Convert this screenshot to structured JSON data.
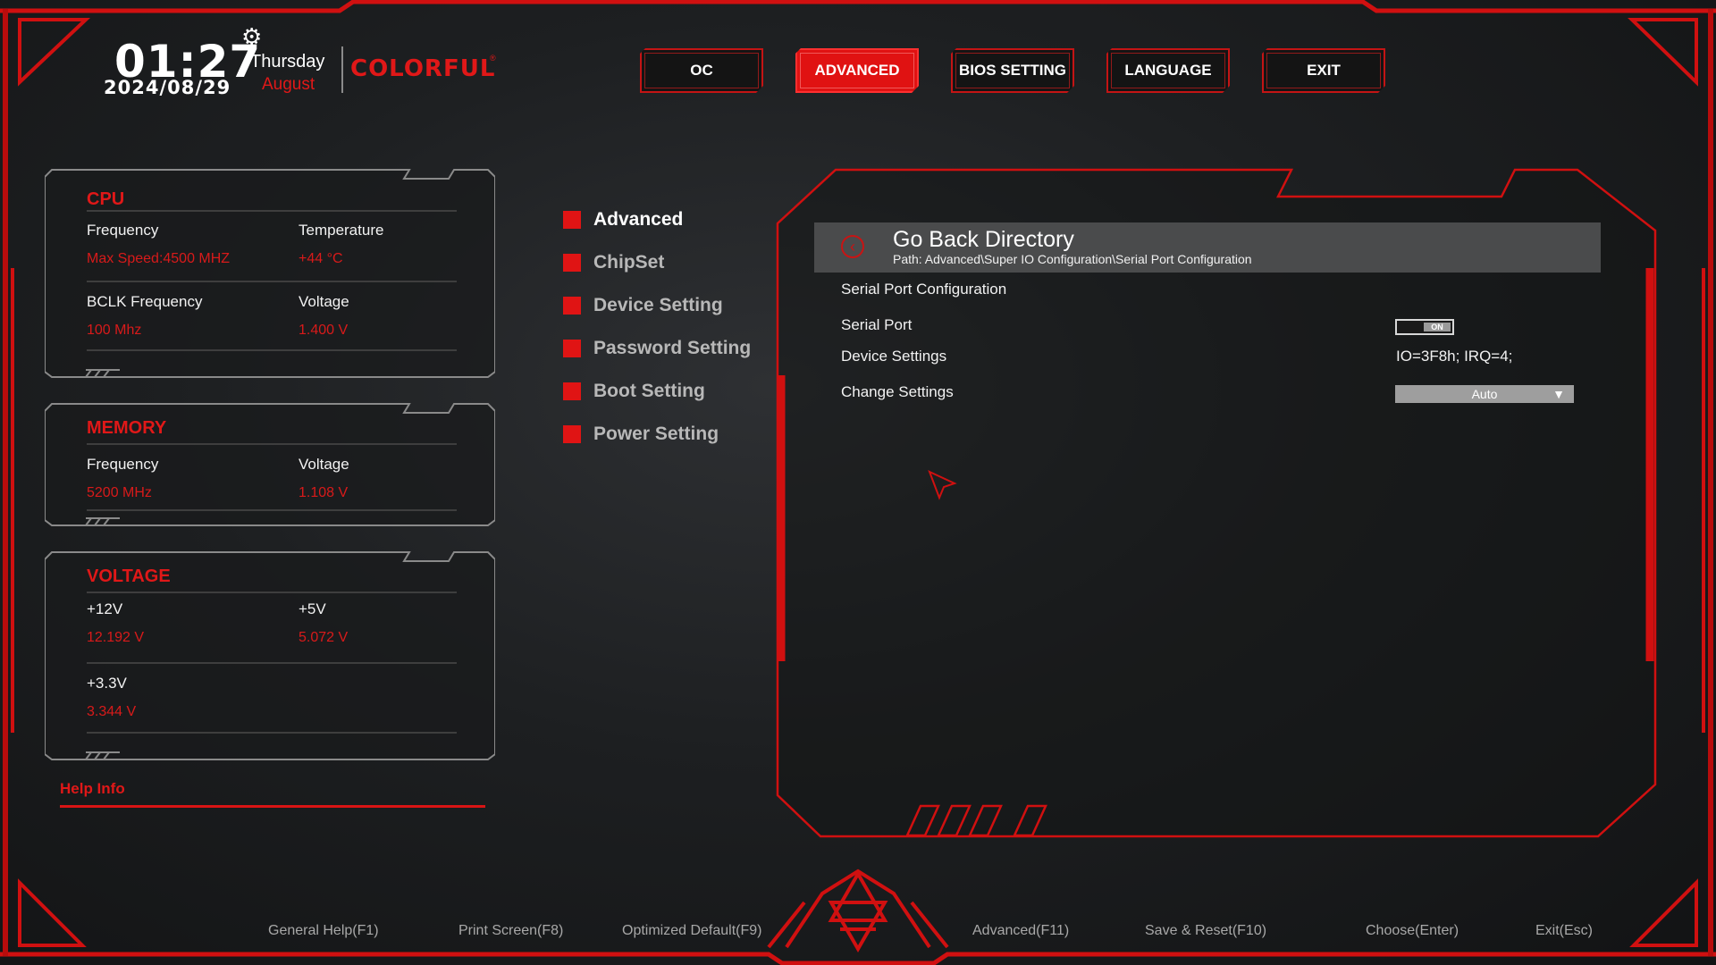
{
  "header": {
    "time": "01:27",
    "date": "2024/08/29",
    "weekday": "Thursday",
    "month": "August",
    "brand": "COLORFUL",
    "brand_mark": "®"
  },
  "nav": [
    "OC",
    "ADVANCED",
    "BIOS SETTING",
    "LANGUAGE",
    "EXIT"
  ],
  "nav_active": "ADVANCED",
  "cpu": {
    "title": "CPU",
    "frequency_label": "Frequency",
    "frequency_value": "Max Speed:4500 MHZ",
    "temperature_label": "Temperature",
    "temperature_value": "+44 °C",
    "bclk_label": "BCLK Frequency",
    "bclk_value": "100 Mhz",
    "voltage_label": "Voltage",
    "voltage_value": "1.400 V"
  },
  "memory": {
    "title": "MEMORY",
    "frequency_label": "Frequency",
    "frequency_value": "5200 MHz",
    "voltage_label": "Voltage",
    "voltage_value": "1.108 V"
  },
  "voltage": {
    "title": "VOLTAGE",
    "v12_label": "+12V",
    "v12_value": "12.192 V",
    "v5_label": "+5V",
    "v5_value": "5.072 V",
    "v33_label": "+3.3V",
    "v33_value": "3.344 V"
  },
  "help_info": "Help Info",
  "submenu": [
    "Advanced",
    "ChipSet",
    "Device Setting",
    "Password Setting",
    "Boot Setting",
    "Power Setting"
  ],
  "content": {
    "go_back_title": "Go Back Directory",
    "path": "Path: Advanced\\Super IO Configuration\\Serial Port Configuration",
    "section_title": "Serial Port Configuration",
    "serial_port_label": "Serial Port",
    "serial_port_toggle": "ON",
    "device_settings_label": "Device Settings",
    "device_settings_value": "IO=3F8h; IRQ=4;",
    "change_settings_label": "Change Settings",
    "change_settings_value": "Auto"
  },
  "footer": [
    "General Help(F1)",
    "Print Screen(F8)",
    "Optimized Default(F9)",
    "Advanced(F11)",
    "Save & Reset(F10)",
    "Choose(Enter)",
    "Exit(Esc)"
  ],
  "colors": {
    "accent": "#e01818",
    "background": "#1d1f21",
    "panel_border": "#8a8a8a",
    "goback_bg": "#4a4b4c"
  }
}
